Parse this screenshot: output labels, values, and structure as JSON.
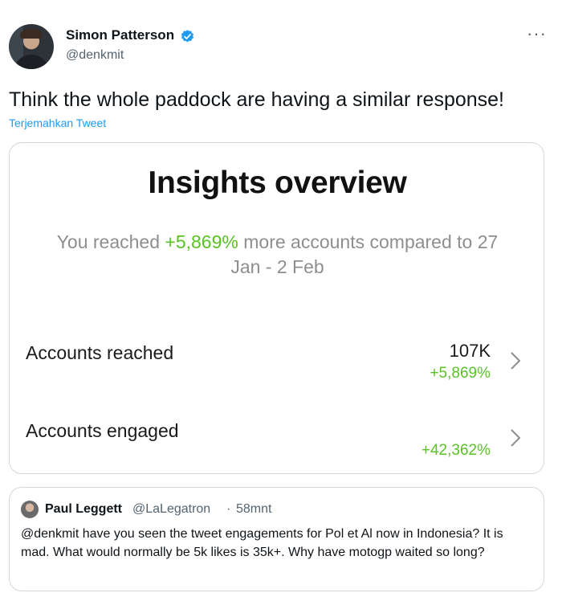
{
  "author": {
    "name": "Simon Patterson",
    "handle": "@denkmit",
    "verified_color": "#1d9bf0"
  },
  "tweet": {
    "text": "Think the whole paddock are having a similar response!",
    "translate_label": "Terjemahkan Tweet",
    "more_icon": "more-dots-icon"
  },
  "insights": {
    "title": "Insights overview",
    "subtitle_prefix": "You reached ",
    "subtitle_highlight": "+5,869%",
    "subtitle_suffix": " more accounts compared to 27 Jan - 2 Feb",
    "positive_color": "#58c322",
    "metrics": [
      {
        "label": "Accounts reached",
        "value": "107K",
        "change": "+5,869%"
      },
      {
        "label": "Accounts engaged",
        "value": "",
        "change": "+42,362%"
      }
    ]
  },
  "quote": {
    "name": "Paul Leggett",
    "handle": "@LaLegatron",
    "separator": "·",
    "time": "58mnt",
    "text": "@denkmit have you seen the tweet engagements for Pol et Al now in Indonesia? It is mad. What would normally be 5k likes is 35k+. Why have motogp waited so long?"
  }
}
